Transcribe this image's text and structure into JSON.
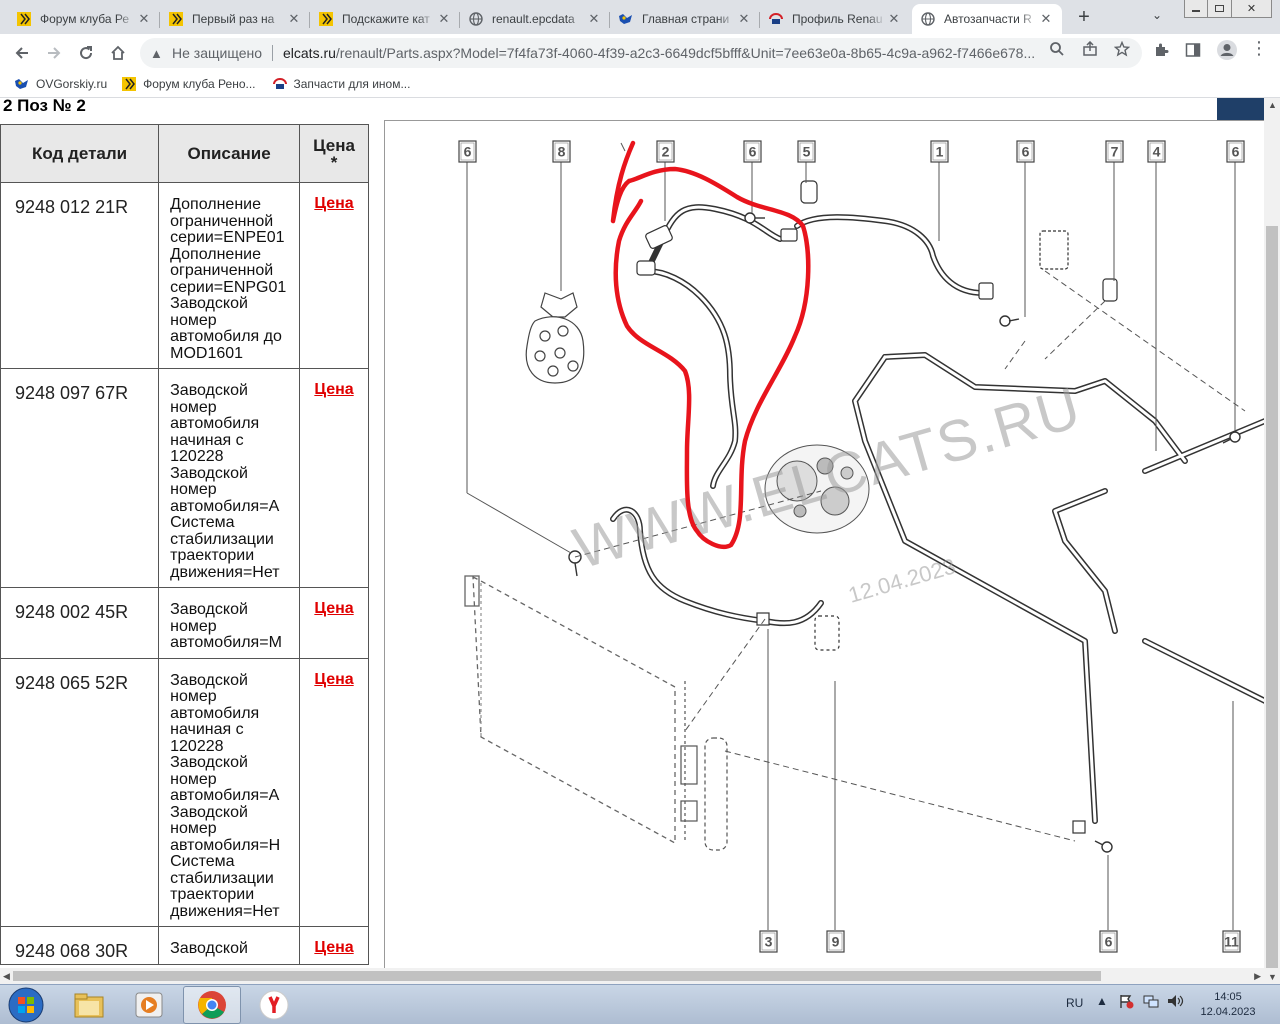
{
  "tabs": [
    {
      "title": "Форум клуба Ре",
      "icon": "renault-forum-icon"
    },
    {
      "title": "Первый раз на",
      "icon": "renault-forum-icon"
    },
    {
      "title": "Подскажите кат",
      "icon": "renault-forum-icon"
    },
    {
      "title": "renault.epcdata",
      "icon": "globe-icon"
    },
    {
      "title": "Главная страни",
      "icon": "ovgorskiy-icon"
    },
    {
      "title": "Профиль Renau",
      "icon": "elcats-icon"
    },
    {
      "title": "Автозапчасти R",
      "icon": "globe-icon",
      "active": true
    }
  ],
  "address_bar": {
    "security_label": "Не защищено",
    "url_host": "elcats.ru",
    "url_path": "/renault/Parts.aspx?Model=7f4fa73f-4060-4f39-a2c3-6649dcf5bfff&Unit=7ee63e0a-8b65-4c9a-a962-f7466e678..."
  },
  "bookmarks": [
    {
      "label": "OVGorskiy.ru",
      "icon": "ovgorskiy-icon"
    },
    {
      "label": "Форум клуба Рено...",
      "icon": "renault-forum-icon"
    },
    {
      "label": "Запчасти для ином...",
      "icon": "elcats-icon"
    }
  ],
  "page": {
    "position_title": "2 Поз № 2",
    "table": {
      "headers": {
        "code": "Код детали",
        "description": "Описание",
        "price": "Цена *"
      },
      "rows": [
        {
          "code": "9248 012 21R",
          "description": [
            "Дополнение",
            "ограниченной",
            "серии=ENPE01",
            "Дополнение",
            "ограниченной",
            "серии=ENPG01",
            "Заводской",
            "номер",
            "автомобиля до",
            "MOD1601"
          ],
          "price_link": "Цена"
        },
        {
          "code": "9248 097 67R",
          "description": [
            "Заводской",
            "номер",
            "автомобиля",
            "начиная с",
            "120228",
            "Заводской",
            "номер",
            "автомобиля=A",
            "Система",
            "стабилизации",
            "траектории",
            "движения=Нет"
          ],
          "price_link": "Цена"
        },
        {
          "code": "9248 002 45R",
          "description": [
            "Заводской",
            "номер",
            "автомобиля=M"
          ],
          "price_link": "Цена"
        },
        {
          "code": "9248 065 52R",
          "description": [
            "Заводской",
            "номер",
            "автомобиля",
            "начиная с",
            "120228",
            "Заводской",
            "номер",
            "автомобиля=A",
            "Заводской",
            "номер",
            "автомобиля=H",
            "Система",
            "стабилизации",
            "траектории",
            "движения=Нет"
          ],
          "price_link": "Цена"
        },
        {
          "code": "9248 068 30R",
          "description": [
            "Заводской"
          ],
          "price_link": "Цена"
        }
      ]
    },
    "diagram": {
      "callouts": [
        "6",
        "8",
        "2",
        "6",
        "5",
        "1",
        "6",
        "7",
        "4",
        "6",
        "3",
        "9",
        "6",
        "11"
      ],
      "watermark": "WWW.ELCATS.RU",
      "watermark_date": "12.04.2023",
      "annotation_color": "#e8141c"
    }
  },
  "taskbar": {
    "apps": [
      {
        "icon": "file-explorer-icon"
      },
      {
        "icon": "media-player-icon"
      },
      {
        "icon": "chrome-icon",
        "active": true
      },
      {
        "icon": "yandex-browser-icon"
      }
    ],
    "language": "RU",
    "time": "14:05",
    "date": "12.04.2023"
  }
}
